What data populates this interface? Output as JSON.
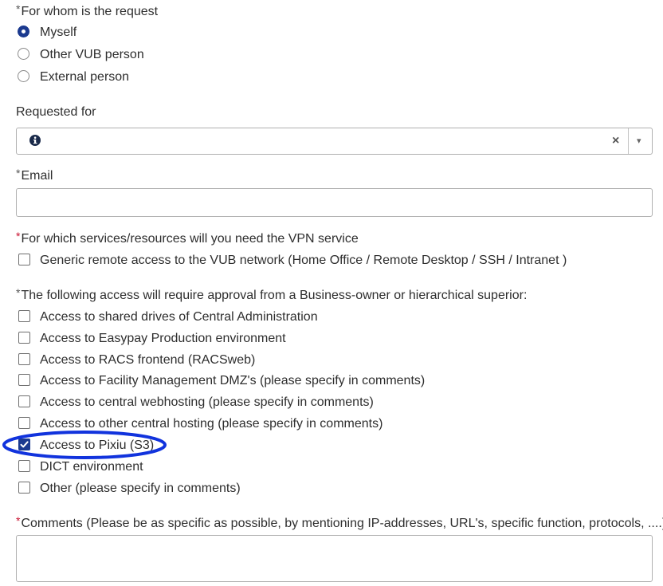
{
  "for_whom": {
    "label": "For whom is the request",
    "options": [
      {
        "label": "Myself",
        "selected": true
      },
      {
        "label": "Other VUB person",
        "selected": false
      },
      {
        "label": "External person",
        "selected": false
      }
    ]
  },
  "requested_for": {
    "label": "Requested for",
    "value": "",
    "info_icon": "info-icon",
    "clear_glyph": "×",
    "dropdown_glyph": "▾"
  },
  "email": {
    "label": "Email",
    "value": ""
  },
  "services": {
    "label": "For which services/resources will you need the VPN service",
    "options": [
      {
        "label": "Generic remote access to the VUB network (Home Office / Remote Desktop / SSH / Intranet )",
        "checked": false
      }
    ]
  },
  "approval": {
    "label": "The following access will require approval from a Business-owner or hierarchical superior:",
    "options": [
      {
        "label": "Access to shared drives of Central Administration",
        "checked": false
      },
      {
        "label": "Access to Easypay Production environment",
        "checked": false
      },
      {
        "label": "Access to RACS frontend (RACSweb)",
        "checked": false
      },
      {
        "label": "Access to Facility Management DMZ's (please specify in comments)",
        "checked": false
      },
      {
        "label": "Access to central webhosting (please specify in comments)",
        "checked": false
      },
      {
        "label": "Access to other central hosting (please specify in comments)",
        "checked": false
      },
      {
        "label": "Access to Pixiu (S3)",
        "checked": true
      },
      {
        "label": "DICT environment",
        "checked": false
      },
      {
        "label": "Other (please specify in comments)",
        "checked": false
      }
    ]
  },
  "comments": {
    "label": "Comments (Please be as specific as possible, by mentioning IP-addresses, URL's, specific function, protocols, ....)",
    "value": ""
  },
  "required_mark": "*",
  "colors": {
    "accent": "#1b3a8f",
    "required_red": "#c8102e",
    "highlight_ellipse": "#1133dd"
  }
}
